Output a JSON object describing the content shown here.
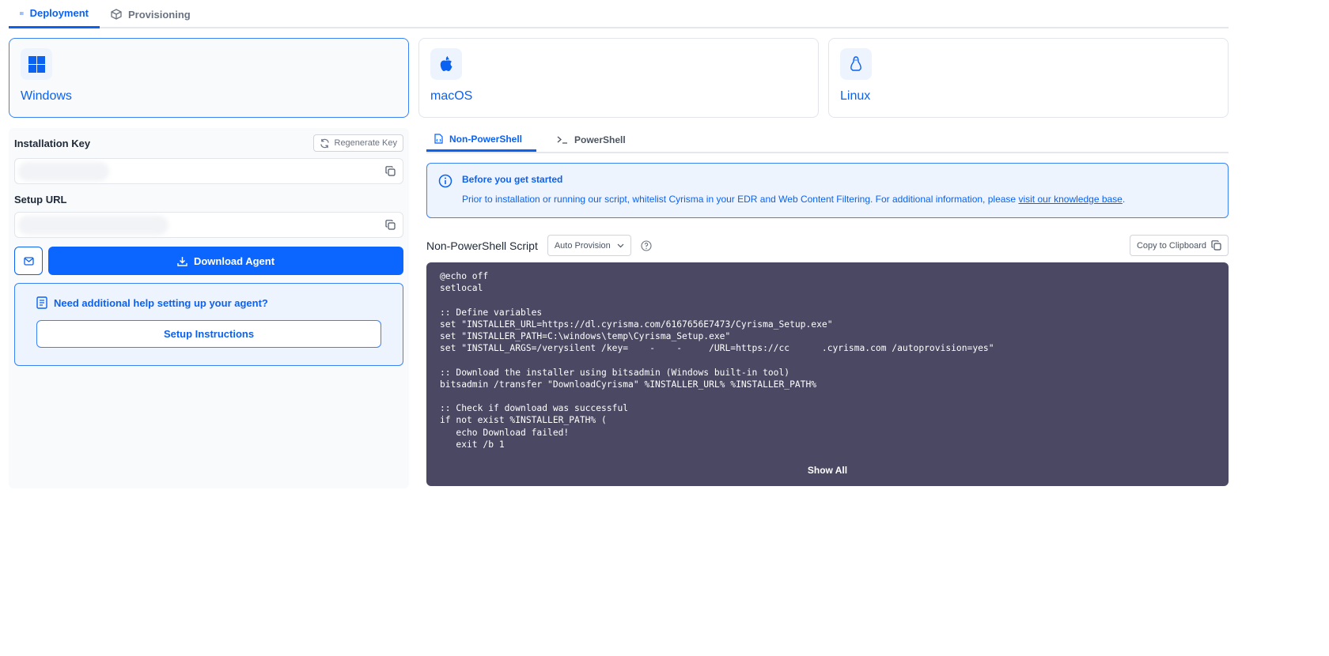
{
  "tabs": [
    {
      "label": "Deployment",
      "icon": "server-icon"
    },
    {
      "label": "Provisioning",
      "icon": "box-icon"
    }
  ],
  "os": [
    {
      "label": "Windows",
      "icon": "windows-icon"
    },
    {
      "label": "macOS",
      "icon": "apple-icon"
    },
    {
      "label": "Linux",
      "icon": "linux-icon"
    }
  ],
  "left": {
    "install_key_label": "Installation Key",
    "regen_label": "Regenerate Key",
    "setup_url_label": "Setup URL",
    "download_label": "Download Agent",
    "help_title": "Need additional help setting up your agent?",
    "setup_instructions": "Setup Instructions"
  },
  "subtabs": [
    {
      "label": "Non-PowerShell"
    },
    {
      "label": "PowerShell"
    }
  ],
  "info": {
    "title": "Before you get started",
    "text": "Prior to installation or running our script, whitelist Cyrisma in your EDR and Web Content Filtering. For additional information, please ",
    "link": "visit our knowledge base",
    "end": "."
  },
  "script": {
    "title": "Non-PowerShell Script",
    "mode": "Auto Provision",
    "copy_label": "Copy to Clipboard",
    "show_all": "Show All",
    "lines": [
      "@echo off",
      "setlocal",
      "",
      ":: Define variables",
      "set \"INSTALLER_URL=https://dl.cyrisma.com/6167656E7473/Cyrisma_Setup.exe\"",
      "set \"INSTALLER_PATH=C:\\windows\\temp\\Cyrisma_Setup.exe\"",
      "set \"INSTALL_ARGS=/verysilent /key=    -    -     /URL=https://cc      .cyrisma.com /autoprovision=yes\"",
      "",
      ":: Download the installer using bitsadmin (Windows built-in tool)",
      "bitsadmin /transfer \"DownloadCyrisma\" %INSTALLER_URL% %INSTALLER_PATH%",
      "",
      ":: Check if download was successful",
      "if not exist %INSTALLER_PATH% (",
      "   echo Download failed!",
      "   exit /b 1"
    ]
  },
  "colors": {
    "accent": "#0b66ff",
    "code_bg": "#4a4862"
  }
}
